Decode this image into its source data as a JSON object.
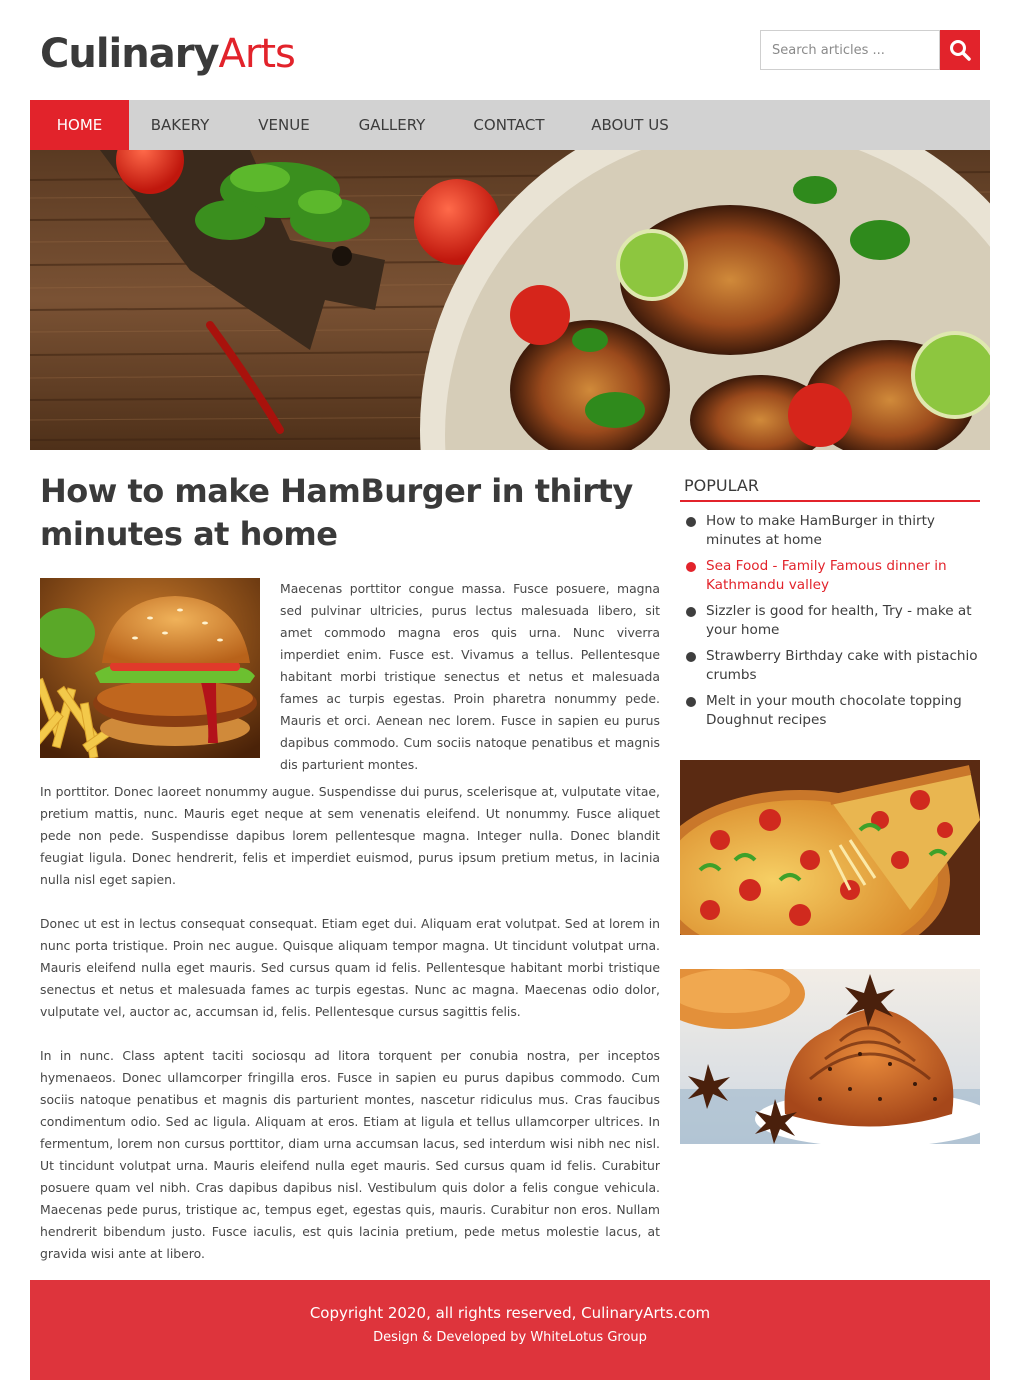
{
  "brand": {
    "part1": "Culinary",
    "part2": "Arts"
  },
  "search": {
    "placeholder": "Search articles ..."
  },
  "nav": {
    "items": [
      {
        "label": "HOME",
        "active": true
      },
      {
        "label": "BAKERY"
      },
      {
        "label": "VENUE"
      },
      {
        "label": "GALLERY"
      },
      {
        "label": "CONTACT"
      },
      {
        "label": "ABOUT US"
      }
    ]
  },
  "article": {
    "title": "How to make HamBurger in thirty minutes at home",
    "intro": "Maecenas porttitor congue massa. Fusce posuere, magna sed pulvinar ultricies, purus lectus malesuada libero, sit amet commodo magna eros quis urna. Nunc viverra imperdiet enim. Fusce est. Vivamus a tellus. Pellentesque habitant morbi tristique senectus et netus et malesuada fames ac turpis egestas. Proin pharetra nonummy pede. Mauris et orci. Aenean nec lorem. Fusce in sapien eu purus dapibus commodo. Cum sociis natoque penatibus et magnis dis parturient montes.",
    "paragraphs": [
      "In porttitor. Donec laoreet nonummy augue. Suspendisse dui purus, scelerisque at, vulputate vitae, pretium mattis, nunc. Mauris eget neque at sem venenatis eleifend. Ut nonummy. Fusce aliquet pede non pede. Suspendisse dapibus lorem pellentesque magna. Integer nulla. Donec blandit feugiat ligula. Donec hendrerit, felis et imperdiet euismod, purus ipsum pretium metus, in lacinia nulla nisl eget sapien.",
      "Donec ut est in lectus consequat consequat. Etiam eget dui. Aliquam erat volutpat. Sed at lorem in nunc porta tristique. Proin nec augue. Quisque aliquam tempor magna. Ut tincidunt volutpat urna. Mauris eleifend nulla eget mauris. Sed cursus quam id felis. Pellentesque habitant morbi tristique senectus et netus et malesuada fames ac turpis egestas. Nunc ac magna. Maecenas odio dolor, vulputate vel, auctor ac, accumsan id, felis. Pellentesque cursus sagittis felis.",
      "In in nunc. Class aptent taciti sociosqu ad litora torquent per conubia nostra, per inceptos hymenaeos. Donec ullamcorper fringilla eros. Fusce in sapien eu purus dapibus commodo. Cum sociis natoque penatibus et magnis dis parturient montes, nascetur ridiculus mus. Cras faucibus condimentum odio. Sed ac ligula. Aliquam at eros. Etiam at ligula et tellus ullamcorper ultrices. In fermentum, lorem non cursus porttitor, diam urna accumsan lacus, sed interdum wisi nibh nec nisl. Ut tincidunt volutpat urna. Mauris eleifend nulla eget mauris. Sed cursus quam id felis. Curabitur posuere quam vel nibh. Cras dapibus dapibus nisl. Vestibulum quis dolor a felis congue vehicula. Maecenas pede purus, tristique ac, tempus eget, egestas quis, mauris. Curabitur non eros. Nullam hendrerit bibendum justo. Fusce iaculis, est quis lacinia pretium, pede metus molestie lacus, at gravida wisi ante at libero."
    ]
  },
  "sidebar": {
    "heading": "POPULAR",
    "items": [
      {
        "label": "How to make HamBurger in thirty minutes at home"
      },
      {
        "label": "Sea Food - Family Famous dinner in Kathmandu valley",
        "highlight": true
      },
      {
        "label": "Sizzler is good for health, Try - make at your home"
      },
      {
        "label": "Strawberry Birthday cake with pistachio crumbs"
      },
      {
        "label": "Melt in your mouth chocolate topping Doughnut recipes"
      }
    ]
  },
  "footer": {
    "copyright": "Copyright 2020, all rights reserved, CulinaryArts.com",
    "credit": "Design & Developed by WhiteLotus Group"
  },
  "colors": {
    "accent": "#e2232b",
    "nav_bg": "#d2d2d2",
    "footer_bg": "#de343c"
  }
}
